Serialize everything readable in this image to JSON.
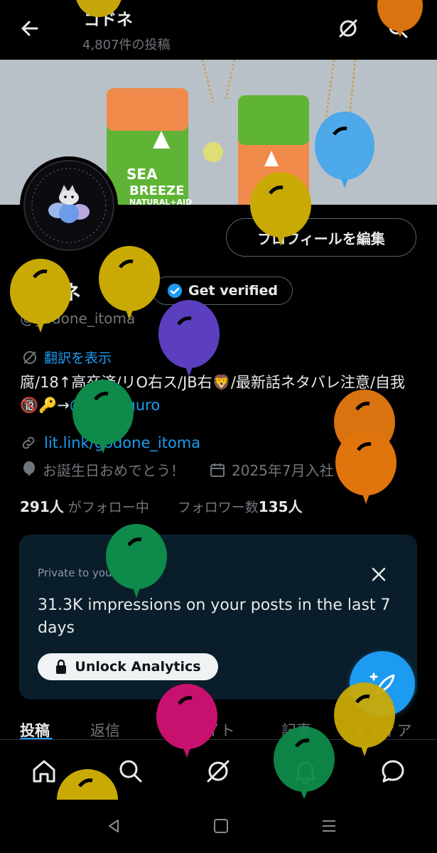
{
  "header": {
    "title": "ゴドネ",
    "post_count": "4,807件の投稿"
  },
  "banner": {
    "text_line1": "SEA",
    "text_line2": "BREEZE",
    "text_line3": "NATURAL+AID"
  },
  "profile": {
    "edit_button": "プロフィールを編集",
    "display_name": "ゴドネ",
    "get_verified": "Get verified",
    "handle": "@godone_itoma",
    "translate": "翻訳を表示",
    "bio_text": "腐/18↑高卒済/リO右ス/JB右🦁/最新話ネタバレ注意/自我🔞🔑→",
    "bio_mention": "@3Leroguro",
    "link": "lit.link/godone_itoma",
    "birthday": "お誕生日おめでとう！",
    "joined": "2025年7月入社",
    "following_count": "291人",
    "following_label": "がフォロー中",
    "followers_label": "フォロワー数",
    "followers_count": "135人"
  },
  "analytics": {
    "private_label": "Private to you",
    "impressions_text": "31.3K impressions on your posts in the last 7 days",
    "unlock_button": "Unlock Analytics"
  },
  "tabs": [
    {
      "label": "投稿",
      "active": true
    },
    {
      "label": "返信",
      "active": false
    },
    {
      "label": "ハイライト",
      "active": false
    },
    {
      "label": "記事",
      "active": false
    },
    {
      "label": "メディア",
      "active": false
    }
  ],
  "icons": {
    "back": "back-arrow-icon",
    "grok": "grok-icon",
    "search": "search-icon",
    "verified": "verified-badge-icon",
    "translate": "translate-icon",
    "link": "link-icon",
    "birthday": "balloon-icon",
    "calendar": "calendar-icon",
    "close": "close-icon",
    "lock": "lock-icon",
    "compose": "compose-icon",
    "home": "home-icon",
    "notifications": "bell-icon",
    "messages": "message-icon"
  },
  "colors": {
    "accent": "#1d9bf0",
    "background": "#000000",
    "card": "#091e2a",
    "muted_text": "#71767b"
  }
}
